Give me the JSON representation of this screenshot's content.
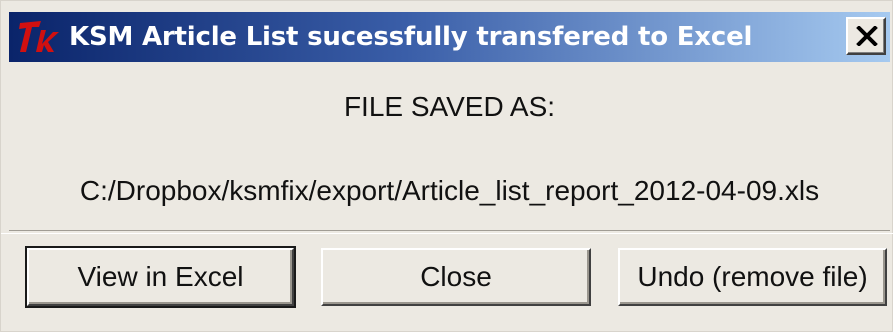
{
  "window": {
    "title": "KSM Article List sucessfully transfered to Excel",
    "app_icon": "tk-feather-icon",
    "close_glyph": "X"
  },
  "message": {
    "line1": "FILE SAVED AS:",
    "line2": "C:/Dropbox/ksmfix/export/Article_list_report_2012-04-09.xls"
  },
  "buttons": {
    "view_label": "View in Excel",
    "close_label": "Close",
    "undo_label": "Undo (remove file)"
  },
  "colors": {
    "titlebar_start": "#0a246a",
    "titlebar_end": "#a6caf0",
    "face": "#ece9e2",
    "icon_red": "#d01010"
  }
}
